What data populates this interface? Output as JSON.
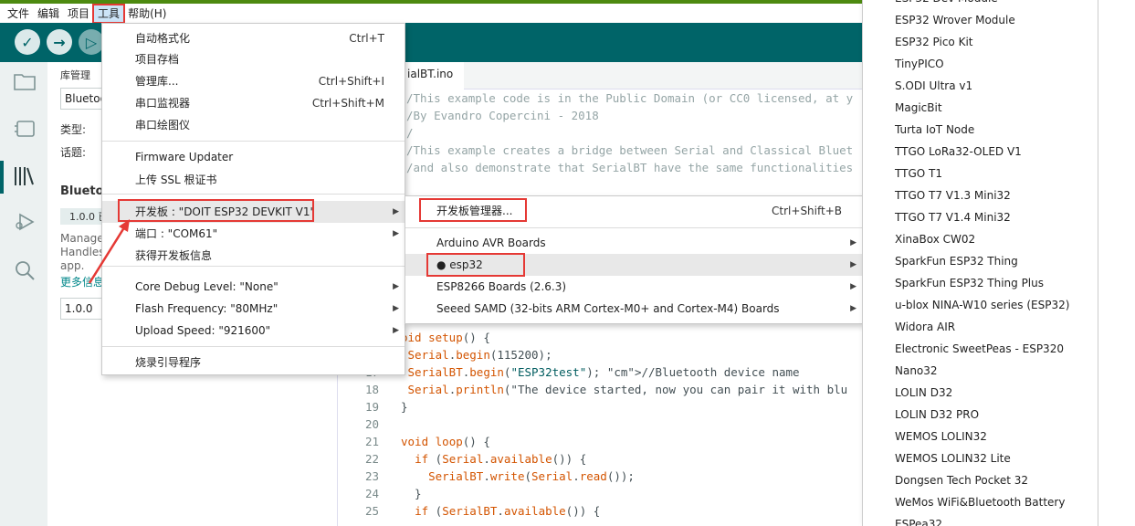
{
  "menubar": {
    "items": [
      "文件",
      "编辑",
      "项目",
      "工具",
      "帮助(H)"
    ]
  },
  "editor": {
    "tab_name": "ialBT.ino",
    "header_comments": [
      "/This example code is in the Public Domain (or CC0 licensed, at y",
      "/By Evandro Copercini - 2018",
      "/",
      "/This example creates a bridge between Serial and Classical Bluet",
      "/and also demonstrate that SerialBT have the same functionalities"
    ],
    "lines": [
      {
        "num": "",
        "code": "oid setup() {"
      },
      {
        "num": "",
        "code": " Serial.begin(115200);"
      },
      {
        "num": "17",
        "code": " SerialBT.begin(\"ESP32test\"); //Bluetooth device name"
      },
      {
        "num": "18",
        "code": " Serial.println(\"The device started, now you can pair it with blu"
      },
      {
        "num": "19",
        "code": "}"
      },
      {
        "num": "20",
        "code": ""
      },
      {
        "num": "21",
        "code": "void loop() {"
      },
      {
        "num": "22",
        "code": "  if (Serial.available()) {"
      },
      {
        "num": "23",
        "code": "    SerialBT.write(Serial.read());"
      },
      {
        "num": "24",
        "code": "  }"
      },
      {
        "num": "25",
        "code": "  if (SerialBT.available()) {"
      }
    ]
  },
  "libpanel": {
    "title": "库管理",
    "search_value": "Bluetoo",
    "type_label": "类型:",
    "topic_label": "话题:",
    "lib_name": "Blueto",
    "version_badge": "1.0.0 已",
    "desc1": "Manage",
    "desc2": "Handles",
    "desc3": "app.",
    "more_info": "更多信息",
    "version_select": "1.0.0"
  },
  "tools_menu": {
    "items": [
      {
        "label": "自动格式化",
        "shortcut": "Ctrl+T"
      },
      {
        "label": "项目存档",
        "shortcut": ""
      },
      {
        "label": "管理库...",
        "shortcut": "Ctrl+Shift+I"
      },
      {
        "label": "串口监视器",
        "shortcut": "Ctrl+Shift+M"
      },
      {
        "label": "串口绘图仪",
        "shortcut": ""
      },
      {
        "label": "Firmware Updater",
        "shortcut": ""
      },
      {
        "label": "上传 SSL 根证书",
        "shortcut": ""
      },
      {
        "label": "开发板 : \"DOIT ESP32 DEVKIT V1\"",
        "shortcut": ""
      },
      {
        "label": "端口 : \"COM61\"",
        "shortcut": ""
      },
      {
        "label": "获得开发板信息",
        "shortcut": ""
      },
      {
        "label": "Core Debug Level: \"None\"",
        "shortcut": ""
      },
      {
        "label": "Flash Frequency: \"80MHz\"",
        "shortcut": ""
      },
      {
        "label": "Upload Speed: \"921600\"",
        "shortcut": ""
      },
      {
        "label": "烧录引导程序",
        "shortcut": ""
      }
    ]
  },
  "board_submenu": {
    "items": [
      {
        "label": "开发板管理器...",
        "shortcut": "Ctrl+Shift+B"
      },
      {
        "label": "Arduino AVR Boards",
        "shortcut": ""
      },
      {
        "label": "● esp32",
        "shortcut": ""
      },
      {
        "label": "ESP8266 Boards (2.6.3)",
        "shortcut": ""
      },
      {
        "label": "Seeed SAMD (32-bits ARM Cortex-M0+ and Cortex-M4) Boards",
        "shortcut": ""
      }
    ]
  },
  "board_list": {
    "items": [
      "ESP32 Dev Module",
      "ESP32 Wrover Module",
      "ESP32 Pico Kit",
      "TinyPICO",
      "S.ODI Ultra v1",
      "MagicBit",
      "Turta IoT Node",
      "TTGO LoRa32-OLED V1",
      "TTGO T1",
      "TTGO T7 V1.3 Mini32",
      "TTGO T7 V1.4 Mini32",
      "XinaBox CW02",
      "SparkFun ESP32 Thing",
      "SparkFun ESP32 Thing Plus",
      "u-blox NINA-W10 series (ESP32)",
      "Widora AIR",
      "Electronic SweetPeas - ESP320",
      "Nano32",
      "LOLIN D32",
      "LOLIN D32 PRO",
      "WEMOS LOLIN32",
      "WEMOS LOLIN32 Lite",
      "Dongsen Tech Pocket 32",
      "WeMos WiFi&Bluetooth Battery",
      "ESPea32"
    ]
  },
  "colors": {
    "toolbar": "#006468",
    "highlight_box": "#e53935",
    "top_stripe": "#4d8a10"
  },
  "icons": [
    "check-icon",
    "arrow-right-icon",
    "debug-icon",
    "folder-icon",
    "board-icon",
    "library-icon",
    "debugger-icon",
    "search-icon"
  ]
}
